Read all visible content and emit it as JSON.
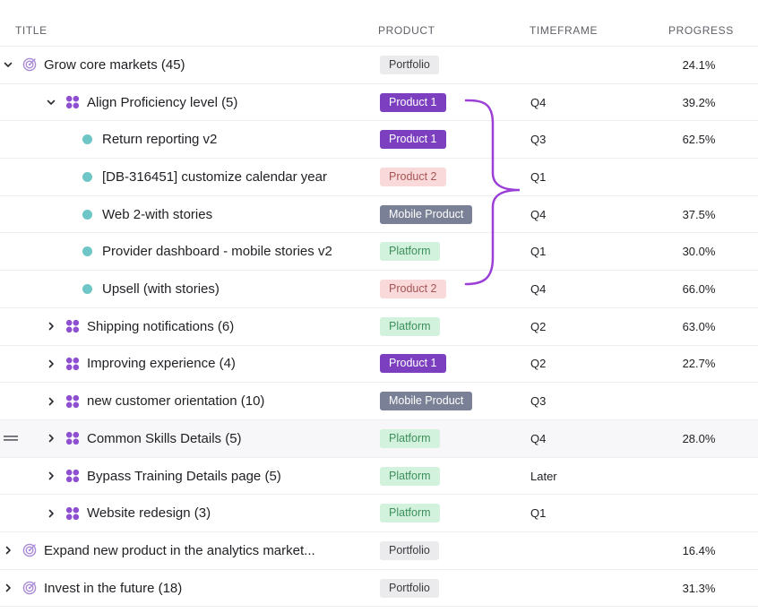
{
  "header": {
    "title": "TITLE",
    "product": "PRODUCT",
    "timeframe": "TIMEFRAME",
    "progress": "PROGRESS"
  },
  "colors": {
    "accent": "#7b3fbf",
    "brace": "#9b3fd6",
    "dot": "#6ec6c6"
  },
  "rows": [
    {
      "title": "Grow core markets (45)",
      "product": "Portfolio",
      "timeframe": "",
      "progress": "24.1%",
      "level": 0,
      "icon": "target-icon",
      "chevron": "expanded"
    },
    {
      "title": "Align Proficiency level (5)",
      "product": "Product 1",
      "timeframe": "Q4",
      "progress": "39.2%",
      "level": 1,
      "icon": "cluster-icon",
      "chevron": "expanded"
    },
    {
      "title": "Return reporting v2",
      "product": "Product 1",
      "timeframe": "Q3",
      "progress": "62.5%",
      "level": 2,
      "icon": "status-dot-icon",
      "chevron": "none"
    },
    {
      "title": "[DB-316451] customize calendar year",
      "product": "Product 2",
      "timeframe": "Q1",
      "progress": "",
      "level": 2,
      "icon": "status-dot-icon",
      "chevron": "none"
    },
    {
      "title": "Web 2-with stories",
      "product": "Mobile Product",
      "timeframe": "Q4",
      "progress": "37.5%",
      "level": 2,
      "icon": "status-dot-icon",
      "chevron": "none"
    },
    {
      "title": "Provider dashboard - mobile stories v2",
      "product": "Platform",
      "timeframe": "Q1",
      "progress": "30.0%",
      "level": 2,
      "icon": "status-dot-icon",
      "chevron": "none"
    },
    {
      "title": "Upsell (with stories)",
      "product": "Product 2",
      "timeframe": "Q4",
      "progress": "66.0%",
      "level": 2,
      "icon": "status-dot-icon",
      "chevron": "none"
    },
    {
      "title": "Shipping notifications (6)",
      "product": "Platform",
      "timeframe": "Q2",
      "progress": "63.0%",
      "level": 1,
      "icon": "cluster-icon",
      "chevron": "collapsed"
    },
    {
      "title": "Improving experience (4)",
      "product": "Product 1",
      "timeframe": "Q2",
      "progress": "22.7%",
      "level": 1,
      "icon": "cluster-icon",
      "chevron": "collapsed"
    },
    {
      "title": "new customer orientation (10)",
      "product": "Mobile Product",
      "timeframe": "Q3",
      "progress": "",
      "level": 1,
      "icon": "cluster-icon",
      "chevron": "collapsed"
    },
    {
      "title": "Common Skills Details (5)",
      "product": "Platform",
      "timeframe": "Q4",
      "progress": "28.0%",
      "level": 1,
      "icon": "cluster-icon",
      "chevron": "collapsed",
      "hover": true
    },
    {
      "title": "Bypass Training Details page (5)",
      "product": "Platform",
      "timeframe": "Later",
      "progress": "",
      "level": 1,
      "icon": "cluster-icon",
      "chevron": "collapsed"
    },
    {
      "title": "Website redesign (3)",
      "product": "Platform",
      "timeframe": "Q1",
      "progress": "",
      "level": 1,
      "icon": "cluster-icon",
      "chevron": "collapsed"
    },
    {
      "title": "Expand new product in the analytics market...",
      "product": "Portfolio",
      "timeframe": "",
      "progress": "16.4%",
      "level": 0,
      "icon": "target-icon",
      "chevron": "collapsed"
    },
    {
      "title": "Invest in the future (18)",
      "product": "Portfolio",
      "timeframe": "",
      "progress": "31.3%",
      "level": 0,
      "icon": "target-icon",
      "chevron": "collapsed"
    }
  ]
}
